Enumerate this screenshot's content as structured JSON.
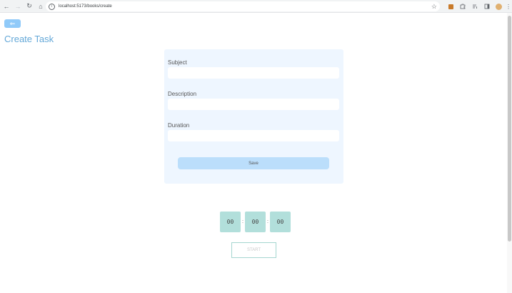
{
  "browser": {
    "url": "localhost:5173/books/create",
    "back_glyph": "←",
    "forward_glyph": "→",
    "reload_glyph": "↻",
    "home_glyph": "⌂",
    "info_glyph": "i",
    "star_glyph": "☆",
    "menu_glyph": "⋮"
  },
  "page": {
    "back_label": "⇐",
    "title": "Create Task"
  },
  "form": {
    "subject_label": "Subject",
    "subject_value": "",
    "description_label": "Description",
    "description_value": "",
    "duration_label": "Duration",
    "duration_value": "",
    "save_label": "Save"
  },
  "timer": {
    "hours": "00",
    "minutes": "00",
    "seconds": "00",
    "separator": ":",
    "start_label": "START"
  },
  "colors": {
    "accent": "#64a8d8",
    "back_button": "#90caf9",
    "card_bg": "#eef6ff",
    "save_bg": "#bbdefb",
    "timer_bg": "#b2dfdb"
  }
}
